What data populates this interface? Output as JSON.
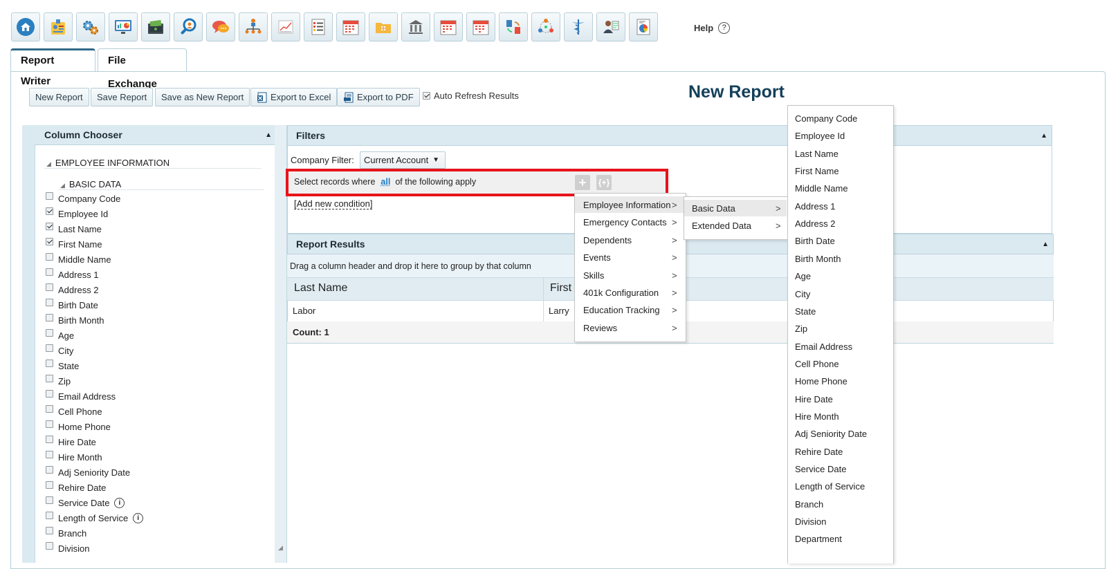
{
  "toolbar": {
    "icons": [
      "home-icon",
      "employee-badge-icon",
      "settings-gears-icon",
      "dashboard-monitor-icon",
      "payroll-cash-icon",
      "search-magnifier-icon",
      "chat-bubbles-icon",
      "org-chart-icon",
      "line-chart-icon",
      "checklist-icon",
      "calendar-icon",
      "folder-icon",
      "bank-icon",
      "calendar-icon",
      "calendar-icon",
      "sync-icon",
      "network-icon",
      "medical-caduceus-icon",
      "user-notes-icon",
      "pie-chart-report-icon"
    ],
    "help_label": "Help",
    "help_symbol": "?"
  },
  "tabs": {
    "report_writer": "Report Writer",
    "file_exchange": "File Exchange"
  },
  "report_toolbar": {
    "new_report": "New Report",
    "save_report": "Save Report",
    "save_as_new": "Save as New Report",
    "export_excel": "Export to Excel",
    "export_pdf": "Export to PDF",
    "auto_refresh": "Auto Refresh Results",
    "auto_refresh_checked": true
  },
  "report_title": "New Report",
  "column_chooser": {
    "title": "Column Chooser",
    "group": "EMPLOYEE INFORMATION",
    "subgroup": "BASIC DATA",
    "items": [
      {
        "label": "Company Code",
        "checked": false
      },
      {
        "label": "Employee Id",
        "checked": true
      },
      {
        "label": "Last Name",
        "checked": true
      },
      {
        "label": "First Name",
        "checked": true
      },
      {
        "label": "Middle Name",
        "checked": false
      },
      {
        "label": "Address 1",
        "checked": false
      },
      {
        "label": "Address 2",
        "checked": false
      },
      {
        "label": "Birth Date",
        "checked": false
      },
      {
        "label": "Birth Month",
        "checked": false
      },
      {
        "label": "Age",
        "checked": false
      },
      {
        "label": "City",
        "checked": false
      },
      {
        "label": "State",
        "checked": false
      },
      {
        "label": "Zip",
        "checked": false
      },
      {
        "label": "Email Address",
        "checked": false
      },
      {
        "label": "Cell Phone",
        "checked": false
      },
      {
        "label": "Home Phone",
        "checked": false
      },
      {
        "label": "Hire Date",
        "checked": false
      },
      {
        "label": "Hire Month",
        "checked": false
      },
      {
        "label": "Adj Seniority Date",
        "checked": false
      },
      {
        "label": "Rehire Date",
        "checked": false
      },
      {
        "label": "Service Date",
        "checked": false,
        "info": true
      },
      {
        "label": "Length of Service",
        "checked": false,
        "info": true
      },
      {
        "label": "Branch",
        "checked": false
      },
      {
        "label": "Division",
        "checked": false
      }
    ]
  },
  "filters": {
    "title": "Filters",
    "company_filter_label": "Company Filter:",
    "company_filter_value": "Current Account",
    "condition_prefix": "Select records where",
    "condition_quantifier": "all",
    "condition_suffix": "of the following apply",
    "add_symbol": "+",
    "group_symbol": "{+}",
    "add_condition": "[Add new condition]"
  },
  "results": {
    "title": "Report Results",
    "group_hint": "Drag a column header and drop it here to group by that column",
    "columns": [
      "Last Name",
      "First"
    ],
    "rows": [
      [
        "Labor",
        "Larry"
      ]
    ],
    "count_label": "Count: 1"
  },
  "menu_categories": {
    "items": [
      "Employee Information",
      "Emergency Contacts",
      "Dependents",
      "Events",
      "Skills",
      "401k Configuration",
      "Education Tracking",
      "Reviews"
    ],
    "arrow": ">"
  },
  "menu_sub": {
    "items": [
      "Basic Data",
      "Extended Data"
    ],
    "arrow": ">"
  },
  "menu_fields": {
    "items": [
      "Company Code",
      "Employee Id",
      "Last Name",
      "First Name",
      "Middle Name",
      "Address 1",
      "Address 2",
      "Birth Date",
      "Birth Month",
      "Age",
      "City",
      "State",
      "Zip",
      "Email Address",
      "Cell Phone",
      "Home Phone",
      "Hire Date",
      "Hire Month",
      "Adj Seniority Date",
      "Rehire Date",
      "Service Date",
      "Length of Service",
      "Branch",
      "Division",
      "Department"
    ]
  },
  "colors": {
    "title": "#14405a",
    "highlight": "#e8141b",
    "link": "#1a7ac2",
    "panel_header": "#dbeaf1"
  }
}
